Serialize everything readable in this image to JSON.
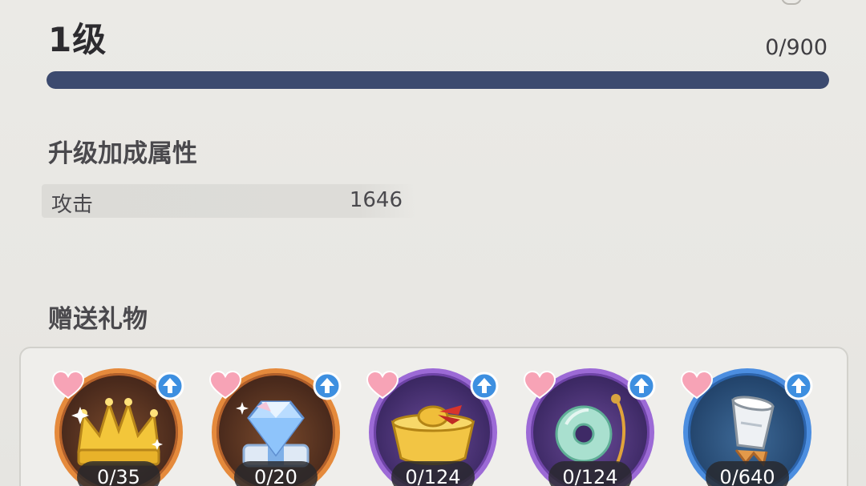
{
  "level": {
    "label": "1级"
  },
  "experience": {
    "text": "0/900",
    "current": 0,
    "max": 900
  },
  "upgrade_bonus": {
    "title": "升级加成属性",
    "attributes": [
      {
        "name": "攻击",
        "value": "1646"
      }
    ]
  },
  "gifts": {
    "title": "赠送礼物",
    "items": [
      {
        "icon": "golden-crown-icon",
        "count": "0/35",
        "rarity": "orange"
      },
      {
        "icon": "diamond-icon",
        "count": "0/20",
        "rarity": "orange"
      },
      {
        "icon": "gold-ingot-icon",
        "count": "0/124",
        "rarity": "purple"
      },
      {
        "icon": "jade-disc-pendant-icon",
        "count": "0/124",
        "rarity": "purple"
      },
      {
        "icon": "silver-cup-icon",
        "count": "0/640",
        "rarity": "blue"
      }
    ]
  },
  "colors": {
    "exp_bar_track": "#3c4a6f",
    "rarity_orange": "#e58a3c",
    "rarity_purple": "#9c6ad6",
    "rarity_blue": "#4c8ee0",
    "heart_pink": "#f7a3b6",
    "upgrade_badge": "#3d8fe0"
  }
}
